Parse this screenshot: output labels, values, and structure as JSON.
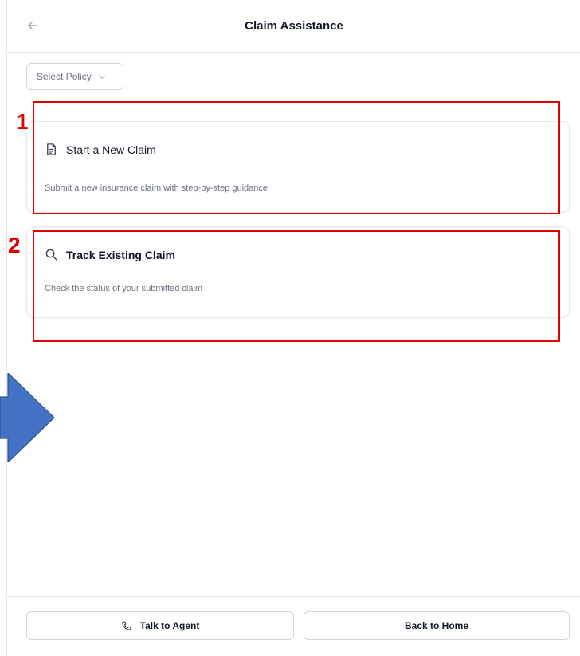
{
  "header": {
    "title": "Claim Assistance",
    "back_icon": "arrow-left-icon"
  },
  "policy_select": {
    "value": "Select Policy",
    "icon": "chevron-down-icon"
  },
  "cards": [
    {
      "icon": "document-icon",
      "title": "Start a New Claim",
      "description": "Submit a new insurance claim with step-by-step guidance"
    },
    {
      "icon": "search-icon",
      "title": "Track Existing Claim",
      "description": "Check the status of your submitted claim"
    }
  ],
  "footer": {
    "talk_label": "Talk to Agent",
    "talk_icon": "phone-icon",
    "home_label": "Back to Home"
  },
  "annotations": {
    "labels": [
      "1",
      "2"
    ],
    "box_color": "#e00000",
    "arrow_color": "#4472c4"
  }
}
